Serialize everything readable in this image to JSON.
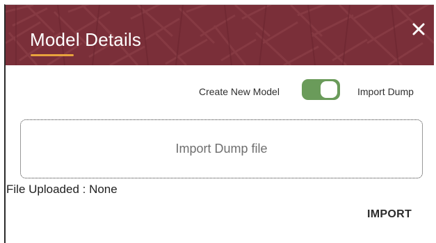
{
  "dialog": {
    "title": "Model Details",
    "close_icon": "close-icon",
    "header_color": "#7a2f39",
    "accent_color": "#e8a33d"
  },
  "toggle": {
    "left_label": "Create New Model",
    "right_label": "Import Dump",
    "state": "on",
    "on_color": "#6a9b5a"
  },
  "dropzone": {
    "label": "Import Dump file"
  },
  "file_status": "File Uploaded : None",
  "actions": {
    "import_label": "IMPORT"
  }
}
